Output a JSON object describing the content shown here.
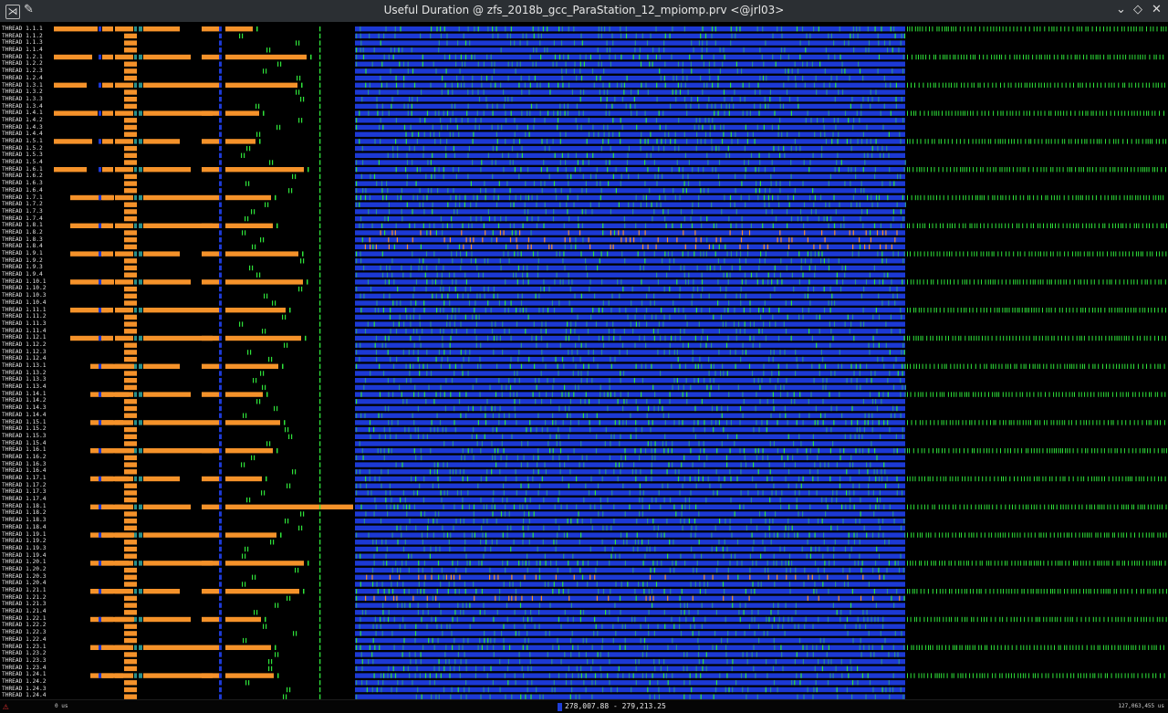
{
  "window": {
    "title": "Useful Duration @ zfs_2018b_gcc_ParaStation_12_mpiomp.prv <@jrl03>",
    "app_icon": "paraver-app-icon",
    "pin_icon": "pin-icon",
    "minimize_glyph": "⌄",
    "maximize_glyph": "◇",
    "close_glyph": "✕"
  },
  "timeline": {
    "process_count": 24,
    "threads_per_process": 4,
    "label_prefix": "THREAD 1.",
    "colors": {
      "background": "#000000",
      "long_useful": "#f5922a",
      "short_useful": "#1c39d4",
      "medium_useful": "#2a8f8a",
      "tiny_useful": "#2fe33a"
    }
  },
  "status": {
    "start_time": "0 us",
    "selected_range": "278,007.88 - 279,213.25",
    "end_time": "127,063,455 us",
    "warning_icon": "warning-icon"
  }
}
